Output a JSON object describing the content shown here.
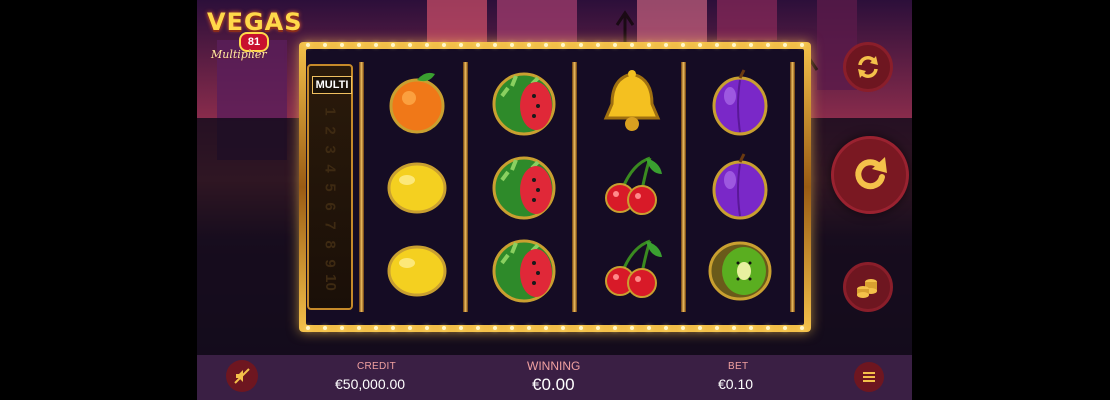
{
  "logo": {
    "title": "VEGAS",
    "number": "81",
    "subtitle": "Multiplier"
  },
  "multiplier": {
    "label": "MULTI",
    "values": [
      "1",
      "2",
      "3",
      "4",
      "5",
      "6",
      "7",
      "8",
      "9",
      "10"
    ]
  },
  "reels": [
    [
      "orange-icon",
      "lemon-icon",
      "lemon-icon"
    ],
    [
      "watermelon-icon",
      "watermelon-icon",
      "watermelon-icon"
    ],
    [
      "bell-icon",
      "cherry-icon",
      "cherry-icon"
    ],
    [
      "plum-icon",
      "plum-icon",
      "kiwi-icon"
    ]
  ],
  "controls": {
    "autoplay": "autoplay-icon",
    "spin": "spin-icon",
    "bet": "coins-icon",
    "sound": "sound-off-icon",
    "menu": "menu-icon"
  },
  "bar": {
    "credit_label": "CREDIT",
    "credit_value": "€50,000.00",
    "winning_label": "WINNING",
    "winning_value": "€0.00",
    "bet_label": "BET",
    "bet_value": "€0.10"
  },
  "colors": {
    "gold": "#f4c14a",
    "button_bg": "#7a1822",
    "bar_bg": "#3a1f44"
  }
}
